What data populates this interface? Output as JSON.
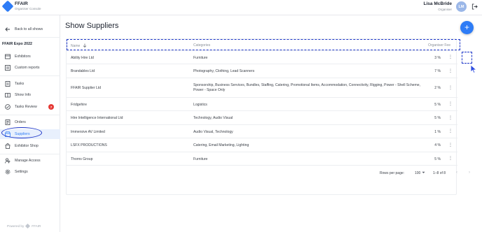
{
  "app": {
    "brand_name": "FFAIR",
    "brand_sub": "Organiser Console",
    "user_name": "Lisa McBride",
    "user_role": "Organiser",
    "user_initials": "LM"
  },
  "sidebar": {
    "back_label": "Back to all shows",
    "section_title": "FFAIR Expo 2022",
    "items": [
      {
        "label": "Exhibitors",
        "icon": "exhibitors-icon"
      },
      {
        "label": "Custom reports",
        "icon": "reports-icon"
      },
      {
        "label": "Tasks",
        "icon": "tasks-icon"
      },
      {
        "label": "Show Info",
        "icon": "show-info-icon"
      },
      {
        "label": "Tasks Review",
        "icon": "tasks-review-icon",
        "badge": "7"
      },
      {
        "label": "Orders",
        "icon": "orders-icon"
      },
      {
        "label": "Suppliers",
        "icon": "suppliers-icon",
        "active": true
      },
      {
        "label": "Exhibitor Shop",
        "icon": "shop-icon"
      },
      {
        "label": "Manage Access",
        "icon": "manage-access-icon"
      },
      {
        "label": "Settings",
        "icon": "settings-icon"
      }
    ],
    "powered_by": "Powered by",
    "powered_brand": "FFAIR"
  },
  "main": {
    "title": "Show Suppliers",
    "add_button": "+",
    "table": {
      "headers": {
        "name": "Name",
        "categories": "Categories",
        "fee": "Organiser Fee"
      },
      "rows": [
        {
          "name": "Ability Hire Ltd",
          "categories": "Furniture",
          "fee": "3 %"
        },
        {
          "name": "Brandables Ltd",
          "categories": "Photography, Clothing, Lead Scanners",
          "fee": "7 %"
        },
        {
          "name": "FFAIR Supplier Ltd",
          "categories": "Sponsorship, Business Services, Bundles, Staffing, Catering, Promotional Items, Accommodation, Connectivity, Rigging, Power - Shell Scheme, Power - Space Only",
          "fee": "2 %"
        },
        {
          "name": "Fridgehire",
          "categories": "Logistics",
          "fee": "5 %"
        },
        {
          "name": "Hire Intelligence International Ltd",
          "categories": "Technology, Audio Visual",
          "fee": "5 %"
        },
        {
          "name": "Immersive AV Limited",
          "categories": "Audio Visual, Technology",
          "fee": "1 %"
        },
        {
          "name": "LSFX PRODUCTIONS",
          "categories": "Catering, Email Marketing, Lighting",
          "fee": "4 %"
        },
        {
          "name": "Thorns Group",
          "categories": "Furniture",
          "fee": "5 %"
        }
      ],
      "more_label": "⋮"
    },
    "footer": {
      "rows_per_page_label": "Rows per page:",
      "rows_per_page_value": "100",
      "range": "1–8 of 8"
    }
  },
  "colors": {
    "accent": "#2e7cf6",
    "annotation": "#1d36c8",
    "badge": "#e53935"
  }
}
